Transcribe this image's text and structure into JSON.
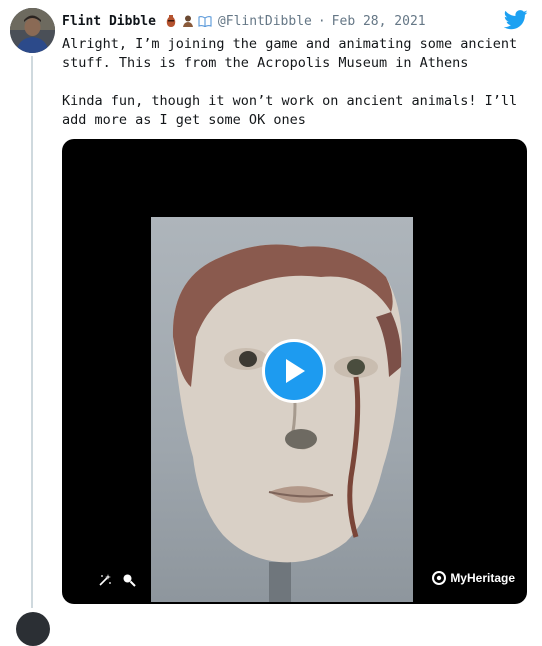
{
  "tweet": {
    "author_name": "Flint Dibble",
    "emojis": [
      "amphora-icon",
      "bust-icon",
      "book-icon"
    ],
    "handle": "@FlintDibble",
    "separator": "·",
    "date": "Feb 28, 2021",
    "paragraphs": [
      "Alright, I’m joining the game and animating some ancient stuff. This is from the Acropolis Museum in Athens",
      "Kinda fun, though it won’t work on ancient animals! I’ll add more as I get some OK ones"
    ]
  },
  "media": {
    "type": "video",
    "watermark": "MyHeritage",
    "play_icon": "play-icon",
    "tool_icons": [
      "magic-wand-icon",
      "search-icon"
    ]
  },
  "colors": {
    "accent": "#1d9bf0",
    "twitter_blue": "#1da1f2",
    "text": "#14171a",
    "muted": "#657786",
    "thread_line": "#cfd9de"
  }
}
